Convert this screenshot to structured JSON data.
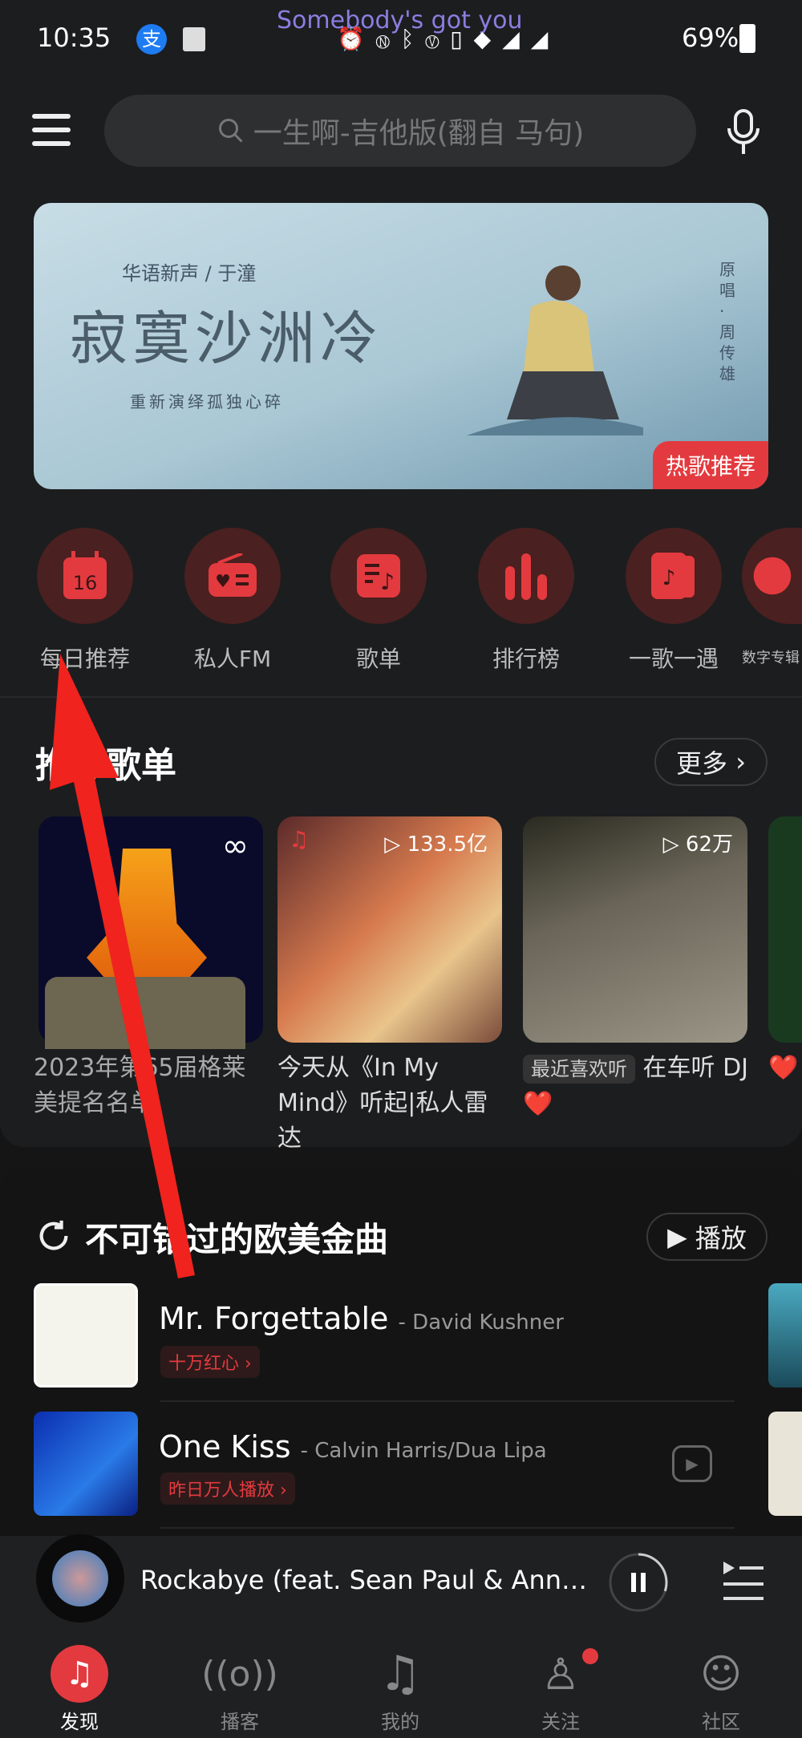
{
  "status_bar": {
    "time": "10:35",
    "media_title": "Somebody's got you",
    "battery": "69%",
    "network": [
      "4G",
      "4G"
    ]
  },
  "search": {
    "placeholder": "一生啊-吉他版(翻自 马句)"
  },
  "banner": {
    "series": "华语新声 / 于潼",
    "title": "寂寞沙洲冷",
    "subtitle": "重新演绎孤独心碎",
    "credit": "原唱·周传雄",
    "badge": "热歌推荐"
  },
  "categories": [
    {
      "label": "每日推荐",
      "icon": "calendar-icon",
      "day": "16"
    },
    {
      "label": "私人FM",
      "icon": "radio-icon"
    },
    {
      "label": "歌单",
      "icon": "playlist-icon"
    },
    {
      "label": "排行榜",
      "icon": "chart-icon"
    },
    {
      "label": "一歌一遇",
      "icon": "music-card-icon"
    },
    {
      "label": "数字专辑",
      "icon": "album-icon"
    }
  ],
  "recommended": {
    "title": "推荐歌单",
    "more": "更多",
    "cards": [
      {
        "title": "2023年第65届格莱美提名名单",
        "icon": "loop-icon"
      },
      {
        "title": "今天从《In My Mind》听起|私人雷达",
        "plays": "133.5亿"
      },
      {
        "tag": "最近喜欢听",
        "title": "在车听 DJ ❤️",
        "plays": "62万"
      },
      {
        "title": "❤️"
      }
    ]
  },
  "section2": {
    "title": "不可错过的欧美金曲",
    "play": "播放",
    "songs": [
      {
        "title": "Mr. Forgettable",
        "artist": "- David Kushner",
        "tag": "十万红心 ›"
      },
      {
        "title": "One Kiss",
        "artist": "- Calvin Harris/Dua Lipa",
        "tag": "昨日万人播放 ›"
      }
    ]
  },
  "mini_player": {
    "title": "Rockabye (feat. Sean Paul & Ann…",
    "progress": 0.3
  },
  "tabs": [
    {
      "label": "发现",
      "active": true
    },
    {
      "label": "播客"
    },
    {
      "label": "我的"
    },
    {
      "label": "关注",
      "badge": true
    },
    {
      "label": "社区"
    }
  ],
  "colors": {
    "accent": "#e33a3f",
    "background": "#151515"
  }
}
